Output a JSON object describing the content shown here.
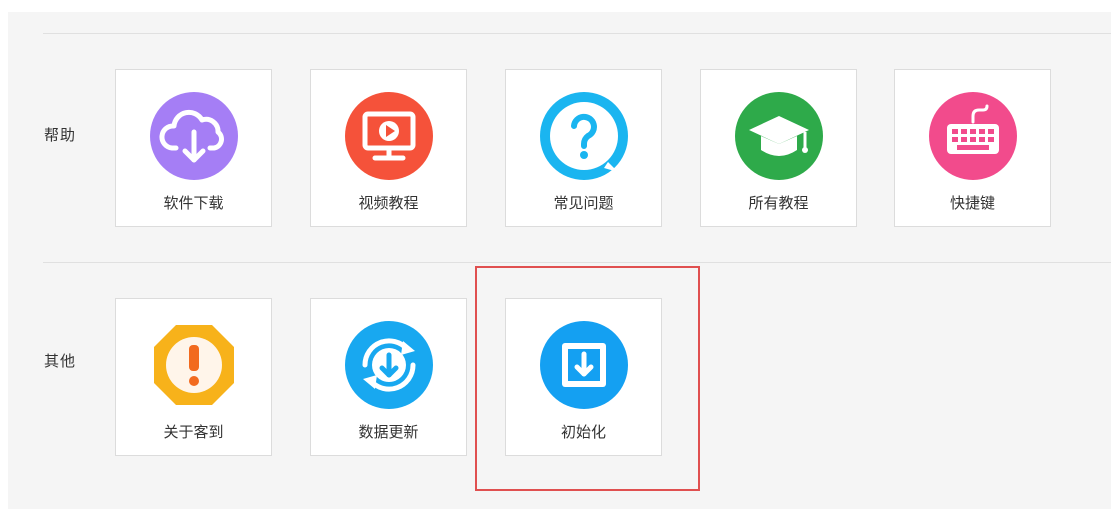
{
  "sections": {
    "help": {
      "title": "帮助",
      "items": [
        {
          "label": "软件下载",
          "icon": "cloud-download-icon",
          "color": "#a57ef5"
        },
        {
          "label": "视频教程",
          "icon": "video-monitor-icon",
          "color": "#f5523a"
        },
        {
          "label": "常见问题",
          "icon": "question-icon",
          "color": "#1ab5f0"
        },
        {
          "label": "所有教程",
          "icon": "graduation-cap-icon",
          "color": "#2eaa4a"
        },
        {
          "label": "快捷键",
          "icon": "keyboard-icon",
          "color": "#f24b8c"
        }
      ]
    },
    "other": {
      "title": "其他",
      "items": [
        {
          "label": "关于客到",
          "icon": "warning-octagon-icon",
          "color": "#f7b21a"
        },
        {
          "label": "数据更新",
          "icon": "refresh-download-icon",
          "color": "#18a8f0"
        },
        {
          "label": "初始化",
          "icon": "download-box-icon",
          "color": "#14a0f2"
        }
      ]
    }
  },
  "highlight_color": "#e05050"
}
